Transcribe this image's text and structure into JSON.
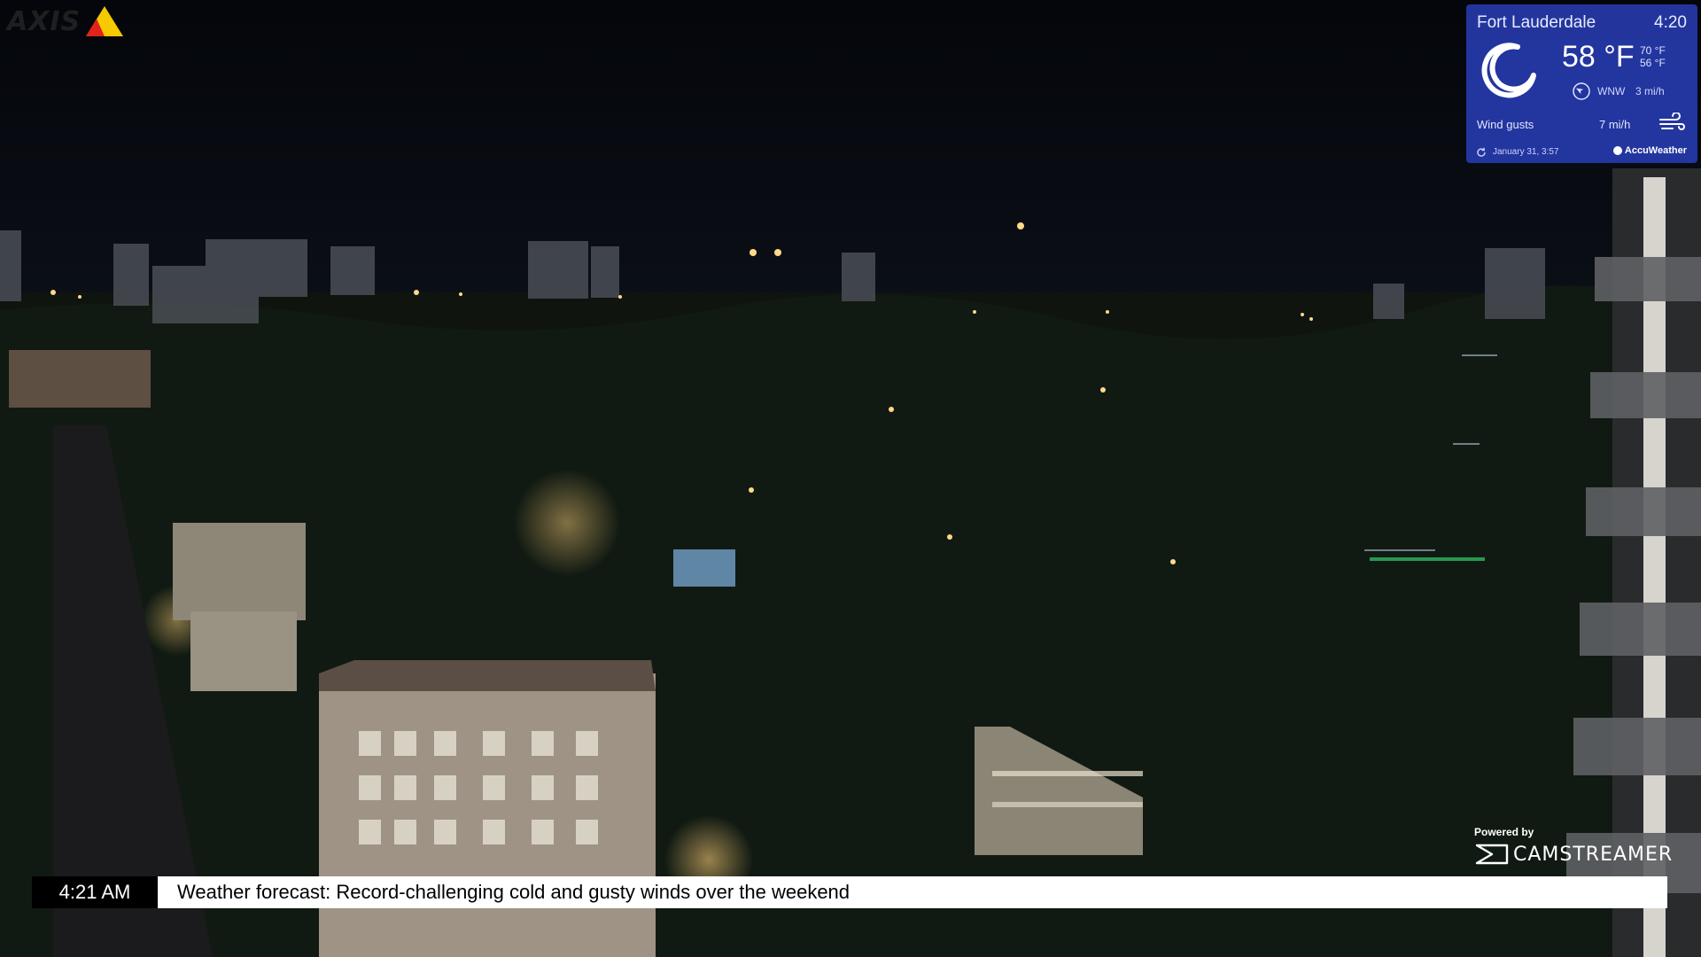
{
  "camera": {
    "logo_text": "AXIS"
  },
  "weather": {
    "city": "Fort Lauderdale",
    "time": "4:20",
    "temperature": "58 °F",
    "high": "70 °F",
    "low": "56 °F",
    "wind_direction": "WNW",
    "wind_speed": "3 mi/h",
    "wind_gusts_label": "Wind gusts",
    "wind_gusts_value": "7 mi/h",
    "updated": "January 31, 3:57",
    "provider": "AccuWeather",
    "condition_icon": "moon-icon"
  },
  "overlay": {
    "powered_by": "Powered by",
    "brand": "CAMSTREAMER"
  },
  "ticker": {
    "time": "4:21 AM",
    "message": "Weather forecast: Record-challenging cold and gusty winds over the weekend"
  },
  "colors": {
    "weather_bg": "#263aaa",
    "ticker_time_bg": "#000000",
    "ticker_msg_bg": "#ffffff",
    "axis_triangle": "#f6c900"
  }
}
